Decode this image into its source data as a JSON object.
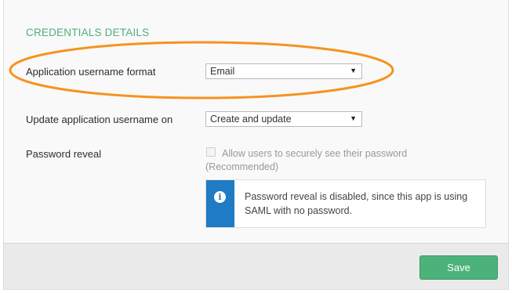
{
  "section": {
    "title": "CREDENTIALS DETAILS"
  },
  "username_format": {
    "label": "Application username format",
    "selected": "Email"
  },
  "update_on": {
    "label": "Update application username on",
    "selected": "Create and update"
  },
  "password_reveal": {
    "label": "Password reveal",
    "checkbox_label": "Allow users to securely see their password",
    "checkbox_note": "(Recommended)",
    "checked": false
  },
  "info": {
    "icon": "info-icon",
    "message": "Password reveal is disabled, since this app is using SAML with no password."
  },
  "footer": {
    "save_label": "Save"
  },
  "colors": {
    "section_title": "#4fae7d",
    "highlight": "#f5931f",
    "info_bar": "#1f7bc4",
    "save_button": "#4bb37a"
  }
}
